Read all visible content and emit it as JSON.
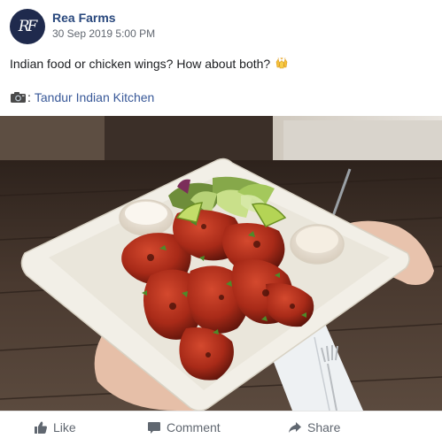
{
  "post": {
    "page_name": "Rea Farms",
    "avatar_monogram": "RF",
    "timestamp": "30 Sep 2019 5:00 PM",
    "caption": "Indian food or chicken wings? How about both?",
    "caption_emoji": "raised-hands-emoji",
    "credit_icon": "camera-icon",
    "credit_separator": ":",
    "credit_link": "Tandur Indian Kitchen"
  },
  "actions": {
    "like_label": "Like",
    "comment_label": "Comment",
    "share_label": "Share"
  },
  "colors": {
    "page_name": "#29487d",
    "link": "#385898",
    "meta_text": "#616770",
    "action_text": "#606770",
    "avatar_bg": "#1f2a4d"
  }
}
